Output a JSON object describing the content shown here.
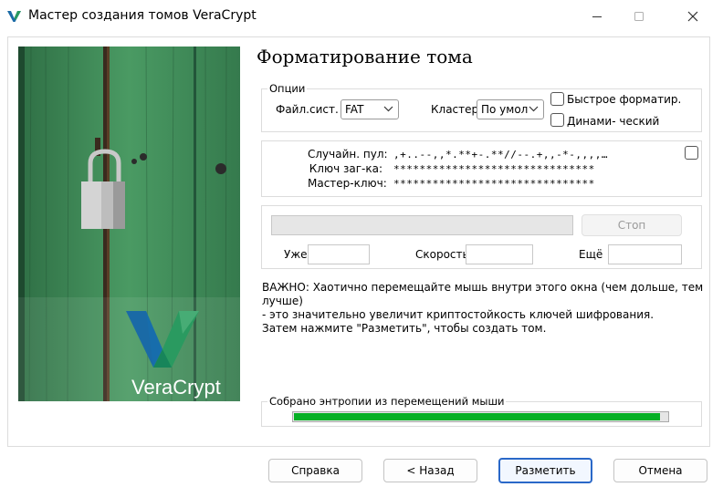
{
  "window": {
    "title": "Мастер создания томов VeraCrypt",
    "accent": "#2a68c8"
  },
  "titlebar_icons": {
    "app": "veracrypt-logo-icon",
    "minimize": "minimize-icon",
    "maximize": "maximize-icon",
    "close": "close-icon"
  },
  "banner": {
    "brand": "VeraCrypt",
    "image": "padlock-on-green-door",
    "colors": {
      "wood": "#3f8c57",
      "logo_blue": "#1a6aa6",
      "logo_green": "#2a9a60"
    }
  },
  "page_title": "Форматирование тома",
  "options": {
    "legend": "Опции",
    "fs_label": "Файл.сист.",
    "fs_value": "FAT",
    "cluster_label": "Кластер",
    "cluster_value": "По умол",
    "quick_format_label": "Быстрое форматир.",
    "quick_format_checked": false,
    "dynamic_label": "Динами- ческий",
    "dynamic_checked": false
  },
  "keys": {
    "random_pool_label": "Случайн. пул:",
    "random_pool_value": ",+..--,,*.**+-.**//--.+,,-*-,,,,…",
    "header_key_label": "Ключ заг-ка:",
    "header_key_value": "*******************************",
    "master_key_label": "Мастер-ключ:",
    "master_key_value": "*******************************",
    "show_checked": false
  },
  "progress": {
    "stop_label": "Стоп",
    "done_label": "Уже",
    "done_value": "",
    "speed_label": "Скорость",
    "speed_value": "",
    "left_label": "Ещё",
    "left_value": "",
    "percent": 0
  },
  "note": {
    "line1": "ВАЖНО: Хаотично перемещайте мышь внутри этого окна (чем дольше, тем лучше)",
    "line2": "- это значительно увеличит криптостойкость ключей шифрования.",
    "line3": "Затем нажмите \"Разметить\", чтобы создать том."
  },
  "entropy": {
    "label": "Собрано энтропии из перемещений мыши",
    "percent": 98,
    "color": "#06b025"
  },
  "buttons": {
    "help": "Справка",
    "back": "< Назад",
    "format": "Разметить",
    "cancel": "Отмена"
  }
}
